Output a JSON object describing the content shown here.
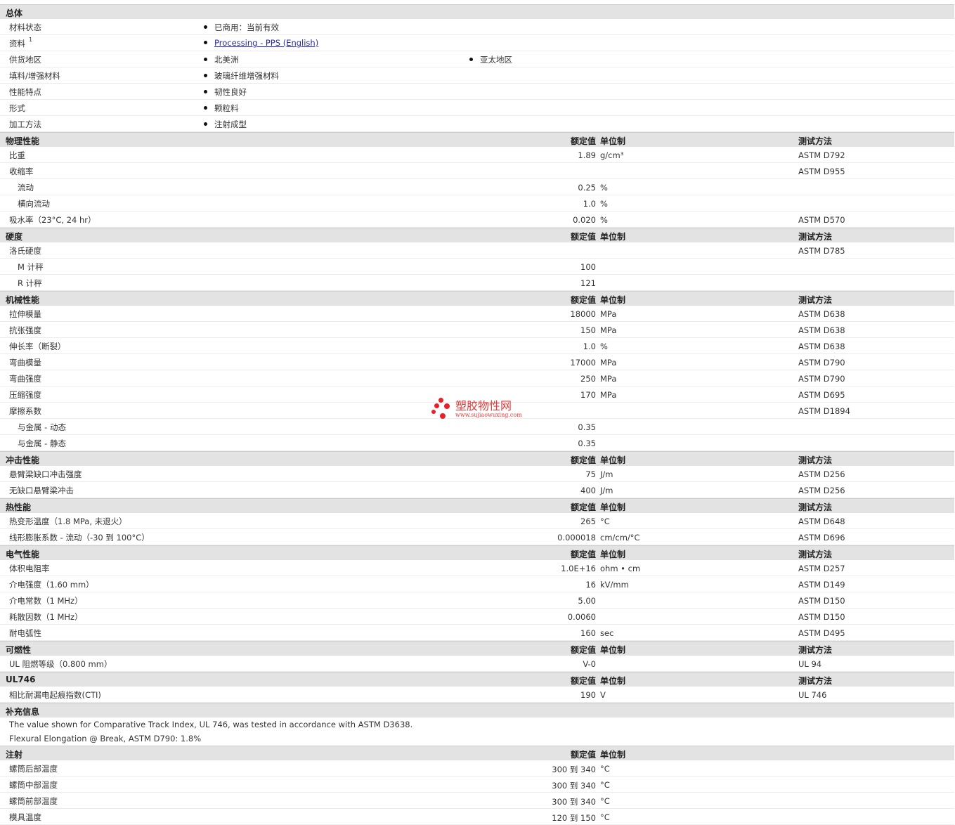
{
  "headers": {
    "nominal": "额定值",
    "unit": "单位制",
    "method": "测试方法"
  },
  "general": {
    "title": "总体",
    "rows": [
      {
        "label": "材料状态",
        "b1": "已商用：当前有效",
        "b2": ""
      },
      {
        "label": "资料",
        "sup": "1",
        "b1": "Processing - PPS (English)",
        "b2": "",
        "link": true
      },
      {
        "label": "供货地区",
        "b1": "北美洲",
        "b2": "亚太地区"
      },
      {
        "label": "填料/增强材料",
        "b1": "玻璃纤维增强材料",
        "b2": ""
      },
      {
        "label": "性能特点",
        "b1": "韧性良好",
        "b2": ""
      },
      {
        "label": "形式",
        "b1": "颗粒料",
        "b2": ""
      },
      {
        "label": "加工方法",
        "b1": "注射成型",
        "b2": ""
      }
    ]
  },
  "sections": [
    {
      "title": "物理性能",
      "rows": [
        {
          "label": "比重",
          "value": "1.89",
          "unit": "g/cm³",
          "method": "ASTM D792"
        },
        {
          "label": "收缩率",
          "value": "",
          "unit": "",
          "method": "ASTM D955"
        },
        {
          "label": "流动",
          "value": "0.25",
          "unit": "%",
          "method": "",
          "sub": true
        },
        {
          "label": "横向流动",
          "value": "1.0",
          "unit": "%",
          "method": "",
          "sub": true
        },
        {
          "label": "吸水率（23°C, 24 hr）",
          "value": "0.020",
          "unit": "%",
          "method": "ASTM D570"
        }
      ]
    },
    {
      "title": "硬度",
      "rows": [
        {
          "label": "洛氏硬度",
          "value": "",
          "unit": "",
          "method": "ASTM D785"
        },
        {
          "label": "M 计秤",
          "value": "100",
          "unit": "",
          "method": "",
          "sub": true
        },
        {
          "label": "R 计秤",
          "value": "121",
          "unit": "",
          "method": "",
          "sub": true
        }
      ]
    },
    {
      "title": "机械性能",
      "rows": [
        {
          "label": "拉伸模量",
          "value": "18000",
          "unit": "MPa",
          "method": "ASTM D638"
        },
        {
          "label": "抗张强度",
          "value": "150",
          "unit": "MPa",
          "method": "ASTM D638"
        },
        {
          "label": "伸长率（断裂）",
          "value": "1.0",
          "unit": "%",
          "method": "ASTM D638"
        },
        {
          "label": "弯曲模量",
          "value": "17000",
          "unit": "MPa",
          "method": "ASTM D790"
        },
        {
          "label": "弯曲强度",
          "value": "250",
          "unit": "MPa",
          "method": "ASTM D790"
        },
        {
          "label": "压缩强度",
          "value": "170",
          "unit": "MPa",
          "method": "ASTM D695"
        },
        {
          "label": "摩擦系数",
          "value": "",
          "unit": "",
          "method": "ASTM D1894"
        },
        {
          "label": "与金属 - 动态",
          "value": "0.35",
          "unit": "",
          "method": "",
          "sub": true
        },
        {
          "label": "与金属 - 静态",
          "value": "0.35",
          "unit": "",
          "method": "",
          "sub": true
        }
      ]
    },
    {
      "title": "冲击性能",
      "rows": [
        {
          "label": "悬臂梁缺口冲击强度",
          "value": "75",
          "unit": "J/m",
          "method": "ASTM D256"
        },
        {
          "label": "无缺口悬臂梁冲击",
          "value": "400",
          "unit": "J/m",
          "method": "ASTM D256"
        }
      ]
    },
    {
      "title": "热性能",
      "rows": [
        {
          "label": "热变形温度（1.8 MPa, 未退火）",
          "value": "265",
          "unit": "°C",
          "method": "ASTM D648"
        },
        {
          "label": "线形膨胀系数 - 流动（-30 到 100°C）",
          "value": "0.000018",
          "unit": "cm/cm/°C",
          "method": "ASTM D696"
        }
      ]
    },
    {
      "title": "电气性能",
      "rows": [
        {
          "label": "体积电阻率",
          "value": "1.0E+16",
          "unit": "ohm • cm",
          "method": "ASTM D257"
        },
        {
          "label": "介电强度（1.60 mm）",
          "value": "16",
          "unit": "kV/mm",
          "method": "ASTM D149"
        },
        {
          "label": "介电常数（1 MHz）",
          "value": "5.00",
          "unit": "",
          "method": "ASTM D150"
        },
        {
          "label": "耗散因数（1 MHz）",
          "value": "0.0060",
          "unit": "",
          "method": "ASTM D150"
        },
        {
          "label": "耐电弧性",
          "value": "160",
          "unit": "sec",
          "method": "ASTM D495"
        }
      ]
    },
    {
      "title": "可燃性",
      "rows": [
        {
          "label": "UL 阻燃等级（0.800 mm）",
          "value": "V-0",
          "unit": "",
          "method": "UL 94"
        }
      ]
    },
    {
      "title": "UL746",
      "rows": [
        {
          "label": "相比耐漏电起痕指数(CTI)",
          "value": "190",
          "unit": "V",
          "method": "UL 746"
        }
      ]
    }
  ],
  "supplement": {
    "title": "补充信息",
    "notes": [
      "The value shown for Comparative Track Index, UL 746, was tested in accordance with ASTM D3638.",
      "Flexural Elongation @ Break, ASTM D790: 1.8%"
    ]
  },
  "injection": {
    "title": "注射",
    "rows": [
      {
        "label": "螺筒后部温度",
        "value": "300 到 340",
        "unit": "°C"
      },
      {
        "label": "螺筒中部温度",
        "value": "300 到 340",
        "unit": "°C"
      },
      {
        "label": "螺筒前部温度",
        "value": "300 到 340",
        "unit": "°C"
      },
      {
        "label": "模具温度",
        "value": "120 到 150",
        "unit": "°C"
      }
    ]
  },
  "watermark": {
    "name": "塑胶物性网",
    "url": "www.sujiaowuxing.com",
    "color": "#e8202a"
  }
}
